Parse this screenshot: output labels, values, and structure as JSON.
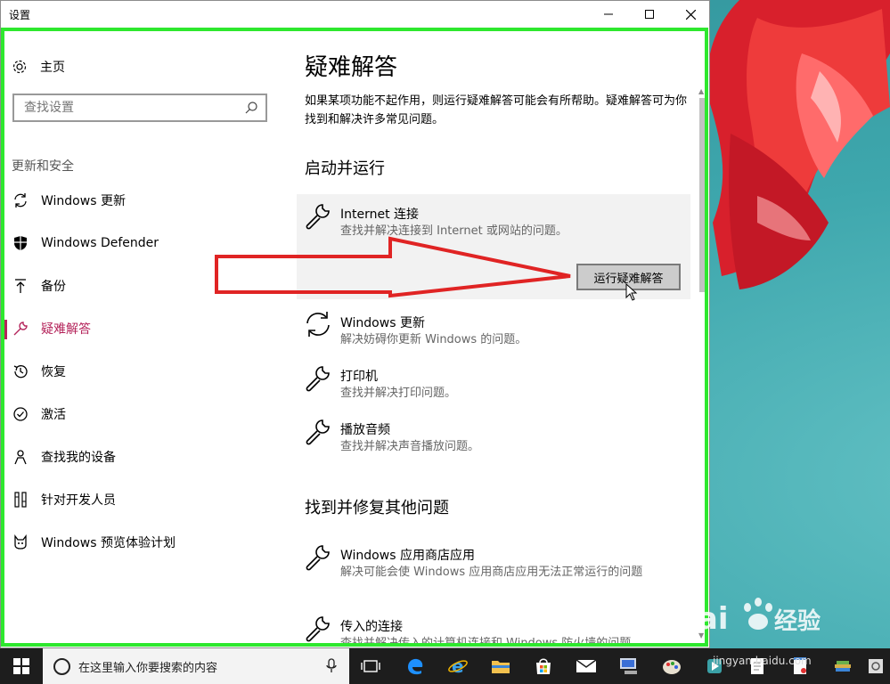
{
  "window": {
    "title": "设置"
  },
  "sidebar": {
    "home_label": "主页",
    "search_placeholder": "查找设置",
    "section_label": "更新和安全",
    "items": [
      {
        "label": "Windows 更新",
        "icon": "refresh-icon"
      },
      {
        "label": "Windows Defender",
        "icon": "shield-icon"
      },
      {
        "label": "备份",
        "icon": "upload-arrow-icon"
      },
      {
        "label": "疑难解答",
        "icon": "wrench-icon",
        "active": true
      },
      {
        "label": "恢复",
        "icon": "history-icon"
      },
      {
        "label": "激活",
        "icon": "check-circle-icon"
      },
      {
        "label": "查找我的设备",
        "icon": "person-locate-icon"
      },
      {
        "label": "针对开发人员",
        "icon": "developer-tools-icon"
      },
      {
        "label": "Windows 预览体验计划",
        "icon": "cat-icon"
      }
    ]
  },
  "content": {
    "title": "疑难解答",
    "description": "如果某项功能不起作用，则运行疑难解答可能会有所帮助。疑难解答可为你找到和解决许多常见问题。",
    "section1_title": "启动并运行",
    "section2_title": "找到并修复其他问题",
    "run_button_label": "运行疑难解答",
    "troubleshooters": [
      {
        "name": "Internet 连接",
        "desc": "查找并解决连接到 Internet 或网站的问题。",
        "icon": "wrench-icon",
        "expanded": true
      },
      {
        "name": "Windows 更新",
        "desc": "解决妨碍你更新 Windows 的问题。",
        "icon": "refresh-icon"
      },
      {
        "name": "打印机",
        "desc": "查找并解决打印问题。",
        "icon": "wrench-icon"
      },
      {
        "name": "播放音频",
        "desc": "查找并解决声音播放问题。",
        "icon": "wrench-icon"
      }
    ],
    "other_troubleshooters": [
      {
        "name": "Windows 应用商店应用",
        "desc": "解决可能会使 Windows 应用商店应用无法正常运行的问题",
        "icon": "wrench-icon"
      },
      {
        "name": "传入的连接",
        "desc": "查找并解决传入的计算机连接和 Windows 防火墙的问题。",
        "icon": "wrench-icon"
      }
    ]
  },
  "taskbar": {
    "search_placeholder": "在这里输入你要搜索的内容"
  },
  "watermark": {
    "text": "jingyan.baidu.com"
  },
  "colors": {
    "accent": "#b4235a",
    "highlight_border": "#2ee82e",
    "arrow": "#e02424"
  }
}
